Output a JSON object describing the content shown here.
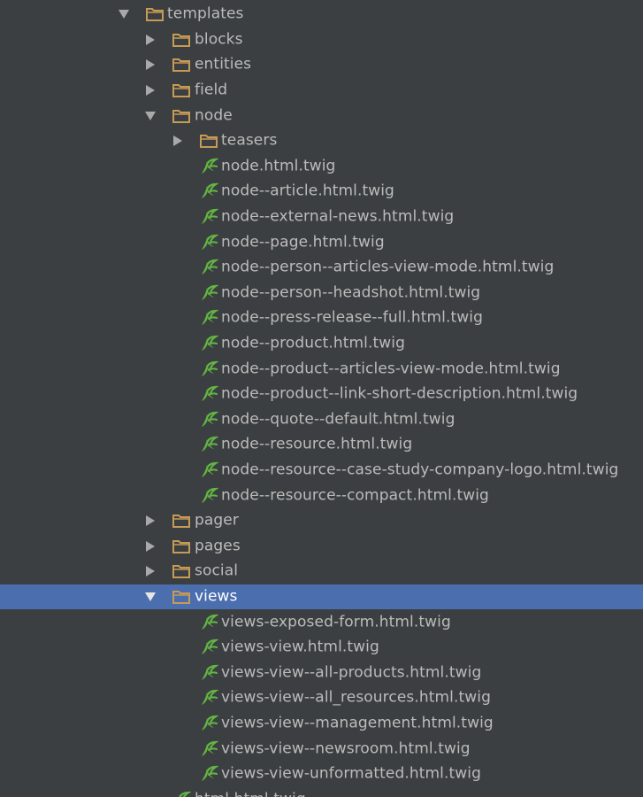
{
  "tree": {
    "items": [
      {
        "label": "templates",
        "type": "folder",
        "state": "open",
        "level": 0
      },
      {
        "label": "blocks",
        "type": "folder",
        "state": "closed",
        "level": 1
      },
      {
        "label": "entities",
        "type": "folder",
        "state": "closed",
        "level": 1
      },
      {
        "label": "field",
        "type": "folder",
        "state": "closed",
        "level": 1
      },
      {
        "label": "node",
        "type": "folder",
        "state": "open",
        "level": 1
      },
      {
        "label": "teasers",
        "type": "folder",
        "state": "closed",
        "level": 2
      },
      {
        "label": "node.html.twig",
        "type": "twig",
        "level": 2
      },
      {
        "label": "node--article.html.twig",
        "type": "twig",
        "level": 2
      },
      {
        "label": "node--external-news.html.twig",
        "type": "twig",
        "level": 2
      },
      {
        "label": "node--page.html.twig",
        "type": "twig",
        "level": 2
      },
      {
        "label": "node--person--articles-view-mode.html.twig",
        "type": "twig",
        "level": 2
      },
      {
        "label": "node--person--headshot.html.twig",
        "type": "twig",
        "level": 2
      },
      {
        "label": "node--press-release--full.html.twig",
        "type": "twig",
        "level": 2
      },
      {
        "label": "node--product.html.twig",
        "type": "twig",
        "level": 2
      },
      {
        "label": "node--product--articles-view-mode.html.twig",
        "type": "twig",
        "level": 2
      },
      {
        "label": "node--product--link-short-description.html.twig",
        "type": "twig",
        "level": 2
      },
      {
        "label": "node--quote--default.html.twig",
        "type": "twig",
        "level": 2
      },
      {
        "label": "node--resource.html.twig",
        "type": "twig",
        "level": 2
      },
      {
        "label": "node--resource--case-study-company-logo.html.twig",
        "type": "twig",
        "level": 2
      },
      {
        "label": "node--resource--compact.html.twig",
        "type": "twig",
        "level": 2
      },
      {
        "label": "pager",
        "type": "folder",
        "state": "closed",
        "level": 1
      },
      {
        "label": "pages",
        "type": "folder",
        "state": "closed",
        "level": 1
      },
      {
        "label": "social",
        "type": "folder",
        "state": "closed",
        "level": 1
      },
      {
        "label": "views",
        "type": "folder",
        "state": "open",
        "level": 1,
        "selected": true
      },
      {
        "label": "views-exposed-form.html.twig",
        "type": "twig",
        "level": 2
      },
      {
        "label": "views-view.html.twig",
        "type": "twig",
        "level": 2
      },
      {
        "label": "views-view--all-products.html.twig",
        "type": "twig",
        "level": 2
      },
      {
        "label": "views-view--all_resources.html.twig",
        "type": "twig",
        "level": 2
      },
      {
        "label": "views-view--management.html.twig",
        "type": "twig",
        "level": 2
      },
      {
        "label": "views-view--newsroom.html.twig",
        "type": "twig",
        "level": 2
      },
      {
        "label": "views-view-unformatted.html.twig",
        "type": "twig",
        "level": 2
      },
      {
        "label": "html.html.twig",
        "type": "twig",
        "level": 1
      }
    ]
  },
  "colors": {
    "background": "#3c3f41",
    "text": "#bbbbbb",
    "selected_background": "#4b6eaf",
    "selected_text": "#ffffff",
    "folder_icon": "#c79a55",
    "twig_icon": "#62b543",
    "arrow": "#a9a9a9"
  },
  "icons": {
    "folder": "folder-icon",
    "twig": "twig-file-icon",
    "expanded": "expand-arrow-icon",
    "collapsed": "collapse-arrow-icon"
  }
}
